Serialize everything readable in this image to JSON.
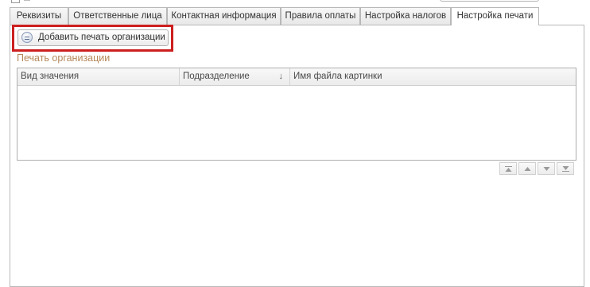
{
  "tabs": [
    {
      "label": "Реквизиты",
      "active": false
    },
    {
      "label": "Ответственные лица",
      "active": false
    },
    {
      "label": "Контактная информация",
      "active": false
    },
    {
      "label": "Правила оплаты",
      "active": false
    },
    {
      "label": "Настройка налогов",
      "active": false
    },
    {
      "label": "Настройка печати",
      "active": true
    }
  ],
  "toolbar": {
    "add_seal_label": "Добавить печать организации",
    "add_seal_icon": "add-circle-icon"
  },
  "highlight_color": "#cc1f1f",
  "group": {
    "title": "Печать организации",
    "title_color": "#b5885a"
  },
  "table": {
    "columns": [
      "Вид значения",
      "Подразделение",
      "Имя файла картинки"
    ],
    "sort_indicator": "↓",
    "rows": []
  },
  "row_nav": {
    "icons": [
      "move-first-icon",
      "move-up-icon",
      "move-down-icon",
      "move-last-icon"
    ]
  }
}
